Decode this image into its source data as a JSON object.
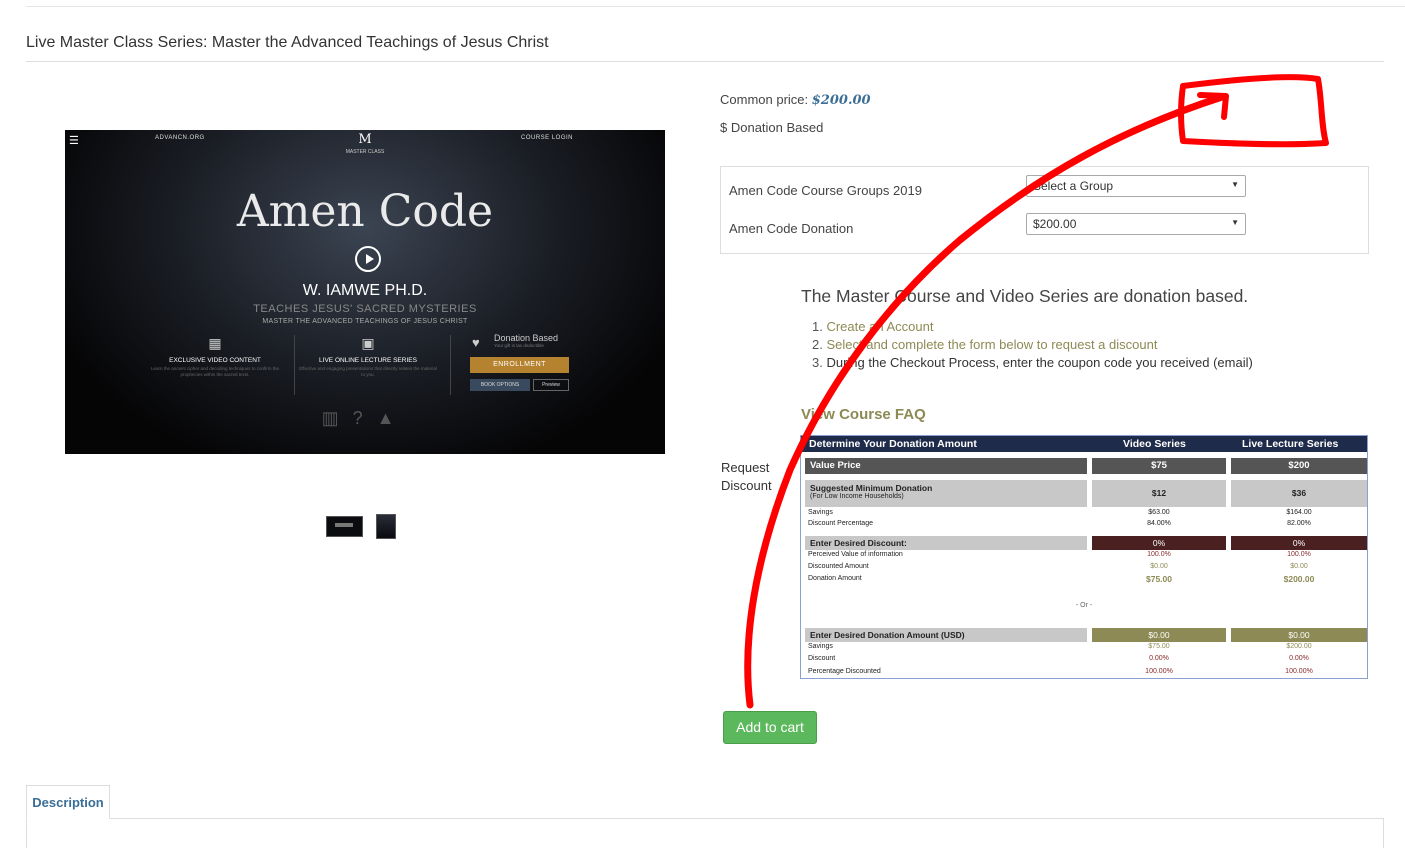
{
  "page": {
    "title": "Live Master Class Series: Master the Advanced Teachings of Jesus Christ"
  },
  "hero": {
    "site": "ADVANCN.ORG",
    "login": "COURSE LOGIN",
    "logo": "M",
    "logo_sub": "MASTER CLASS",
    "headline": "Amen Code",
    "author": "W. IAMWE PH.D.",
    "tagline": "TEACHES JESUS' SACRED MYSTERIES",
    "subtag": "MASTER THE ADVANCED TEACHINGS OF JESUS CHRIST",
    "col1_title": "EXCLUSIVE VIDEO CONTENT",
    "col1_desc": "Learn the ancient cipher and decoding techniques to confirm the prophecies within the sacred texts.",
    "col2_title": "LIVE ONLINE LECTURE SERIES",
    "col2_desc": "Effective and engaging presentations that directly relates the material to you.",
    "donation_label": "Donation Based",
    "donation_sub": "Your gift is tax deductible",
    "enroll": "ENROLLMENT",
    "book_options": "BOOK OPTIONS",
    "preview": "Preview"
  },
  "pricing": {
    "common_label": "Common price:",
    "common_value": "$200.00",
    "donation_based": "$ Donation Based"
  },
  "options": {
    "groups_label": "Amen Code Course Groups 2019",
    "groups_value": "Select a Group",
    "donation_label": "Amen Code Donation",
    "donation_value": "$200.00"
  },
  "info": {
    "heading": "The Master Course and Video Series are donation based.",
    "step1": "Create an Account",
    "step2": "Select and complete the form below to request a discount",
    "step3": "During the Checkout Process, enter the coupon code you received (email)",
    "faq": "View Course FAQ",
    "request_discount": "Request Discount"
  },
  "calc": {
    "h_left": "Determine Your Donation Amount",
    "h_video": "Video Series",
    "h_live": "Live Lecture Series",
    "value_price": "Value Price",
    "vp_video": "$75",
    "vp_live": "$200",
    "smd": "Suggested Minimum Donation",
    "smd_sub": "(For Low Income Households)",
    "smd_video": "$12",
    "smd_live": "$36",
    "savings": "Savings",
    "sav_video": "$63.00",
    "sav_live": "$164.00",
    "disc_pct": "Discount Percentage",
    "dp_video": "84.00%",
    "dp_live": "82.00%",
    "enter_disc": "Enter Desired Discount:",
    "ed_video": "0%",
    "ed_live": "0%",
    "perceived": "Perceived Value of information",
    "pv_video": "100.0%",
    "pv_live": "100.0%",
    "disc_amt": "Discounted Amount",
    "da_video": "$0.00",
    "da_live": "$0.00",
    "don_amt": "Donation Amount",
    "don_video": "$75.00",
    "don_live": "$200.00",
    "or": "- Or -",
    "enter_amt": "Enter Desired Donation Amount (USD)",
    "ea_video": "$0.00",
    "ea_live": "$0.00",
    "savings2": "Savings",
    "s2_video": "$75.00",
    "s2_live": "$200.00",
    "discount": "Discount",
    "d2_video": "0.00%",
    "d2_live": "0.00%",
    "pct_disc": "Percentage Discounted",
    "pd_video": "100.00%",
    "pd_live": "100.00%"
  },
  "actions": {
    "add_to_cart": "Add to cart"
  },
  "tabs": {
    "description": "Description"
  },
  "icons": [
    "menu-icon",
    "play-icon",
    "clapperboard-icon",
    "monitor-icon",
    "heart-icon",
    "chart-icon",
    "question-icon",
    "graduation-cap-icon"
  ],
  "annotation_color": "#ff0000"
}
